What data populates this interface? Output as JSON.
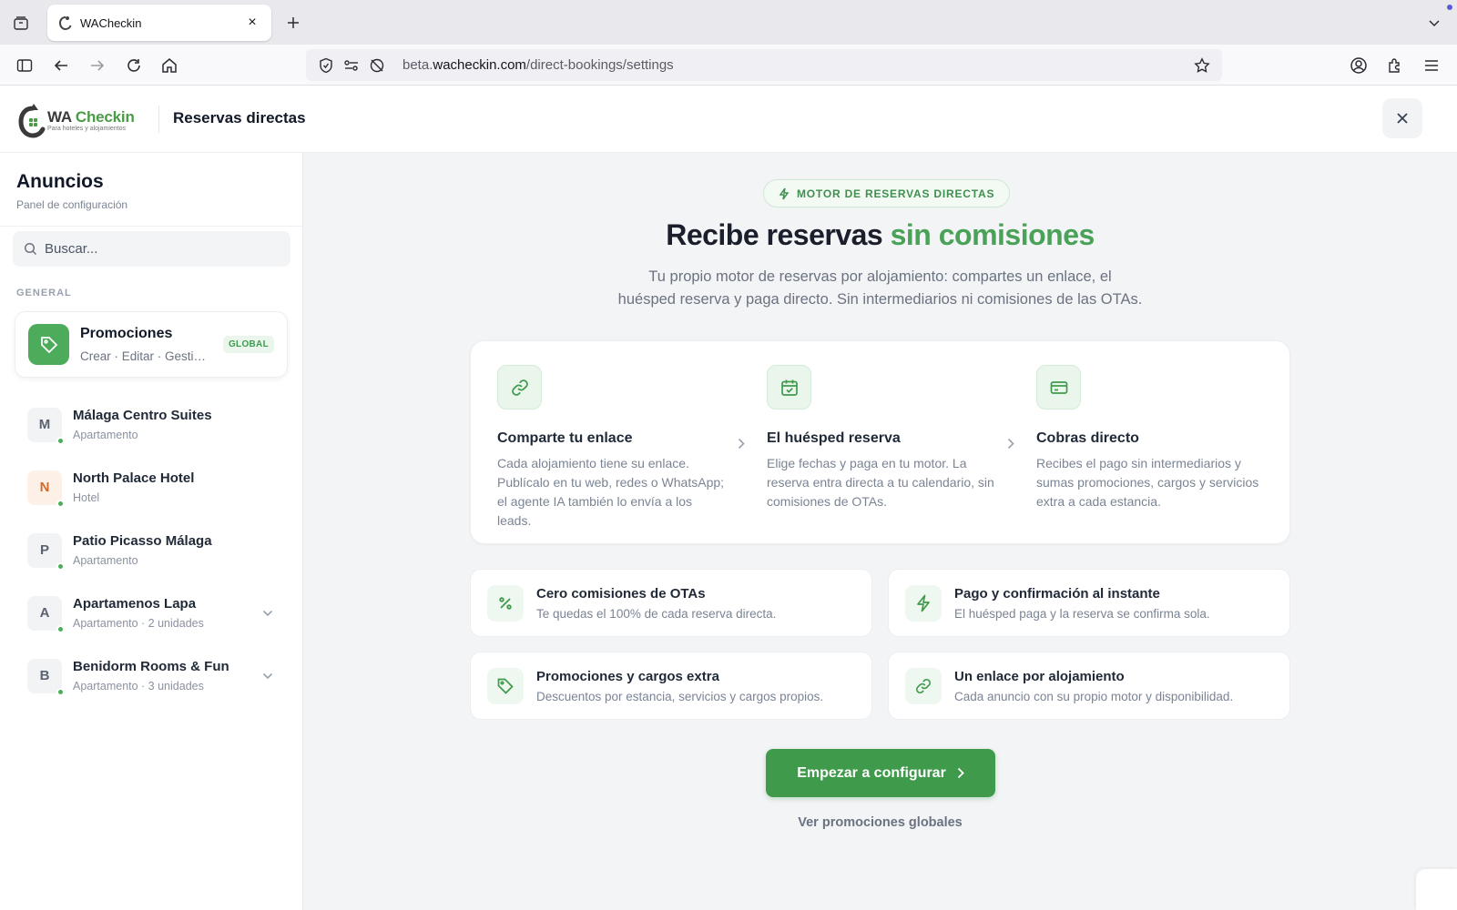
{
  "browser": {
    "tab_title": "WACheckin",
    "url_prefix": "beta.",
    "url_host": "wacheckin.com",
    "url_path": "/direct-bookings/settings"
  },
  "header": {
    "logo_text_1": "WA",
    "logo_text_2": "Checkin",
    "logo_tagline": "Para hoteles y alojamientos",
    "page_title": "Reservas directas"
  },
  "sidebar": {
    "title": "Anuncios",
    "subtitle": "Panel de configuración",
    "search_placeholder": "Buscar...",
    "section_label": "GENERAL",
    "promo": {
      "title": "Promociones",
      "subtitle": "Crear · Editar · Gestionar",
      "badge": "GLOBAL"
    },
    "properties": [
      {
        "initial": "M",
        "name": "Málaga Centro Suites",
        "type": "Apartamento",
        "expandable": false
      },
      {
        "initial": "N",
        "name": "North Palace Hotel",
        "type": "Hotel",
        "expandable": false
      },
      {
        "initial": "P",
        "name": "Patio Picasso Málaga",
        "type": "Apartamento",
        "expandable": false
      },
      {
        "initial": "A",
        "name": "Apartamenos Lapa",
        "type": "Apartamento · 2 unidades",
        "expandable": true
      },
      {
        "initial": "B",
        "name": "Benidorm Rooms & Fun",
        "type": "Apartamento · 3 unidades",
        "expandable": true
      }
    ]
  },
  "main": {
    "pill": "MOTOR DE RESERVAS DIRECTAS",
    "hero_part1": "Recibe reservas ",
    "hero_part2": "sin comisiones",
    "lede_line1": "Tu propio motor de reservas por alojamiento: compartes un enlace, el",
    "lede_line2": "huésped reserva y paga directo. Sin intermediarios ni comisiones de las OTAs.",
    "steps": [
      {
        "icon": "link-icon",
        "title": "Comparte tu enlace",
        "desc": "Cada alojamiento tiene su enlace. Publícalo en tu web, redes o WhatsApp; el agente IA también lo envía a los leads."
      },
      {
        "icon": "calendar-check-icon",
        "title": "El huésped reserva",
        "desc": "Elige fechas y paga en tu motor. La reserva entra directa a tu calendario, sin comisiones de OTAs."
      },
      {
        "icon": "credit-card-icon",
        "title": "Cobras directo",
        "desc": "Recibes el pago sin intermediarios y sumas promociones, cargos y servicios extra a cada estancia."
      }
    ],
    "features": [
      {
        "icon": "percent-icon",
        "title": "Cero comisiones de OTAs",
        "desc": "Te quedas el 100% de cada reserva directa."
      },
      {
        "icon": "bolt-icon",
        "title": "Pago y confirmación al instante",
        "desc": "El huésped paga y la reserva se confirma sola."
      },
      {
        "icon": "tag-icon",
        "title": "Promociones y cargos extra",
        "desc": "Descuentos por estancia, servicios y cargos propios."
      },
      {
        "icon": "link-icon",
        "title": "Un enlace por alojamiento",
        "desc": "Cada anuncio con su propio motor y disponibilidad."
      }
    ],
    "cta_label": "Empezar a configurar",
    "secondary_link": "Ver promociones globales"
  },
  "colors": {
    "accent_green": "#3f9a4c",
    "light_green": "#eaf6ec",
    "status_online": "#4cae5a"
  }
}
